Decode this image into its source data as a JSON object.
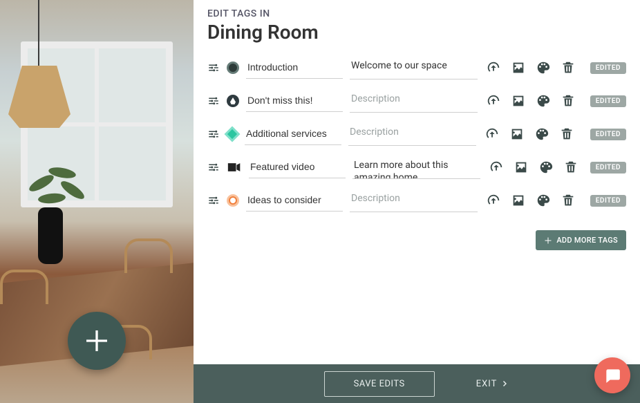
{
  "header": {
    "subtitle": "EDIT TAGS IN",
    "title": "Dining Room"
  },
  "placeholders": {
    "description": "Description"
  },
  "tags": [
    {
      "marker": "circle-dark",
      "name": "Introduction",
      "description": "Welcome to our space",
      "badge": "EDITED"
    },
    {
      "marker": "droplet",
      "name": "Don't miss this!",
      "description": "",
      "badge": "EDITED"
    },
    {
      "marker": "diamond",
      "name": "Additional services",
      "description": "",
      "badge": "EDITED"
    },
    {
      "marker": "video",
      "name": "Featured video",
      "description": "Learn more about this amazing home",
      "badge": "EDITED"
    },
    {
      "marker": "bulb",
      "name": "Ideas to consider",
      "description": "",
      "badge": "EDITED"
    }
  ],
  "buttons": {
    "add_more": "ADD MORE TAGS",
    "save": "SAVE EDITS",
    "exit": "EXIT"
  }
}
